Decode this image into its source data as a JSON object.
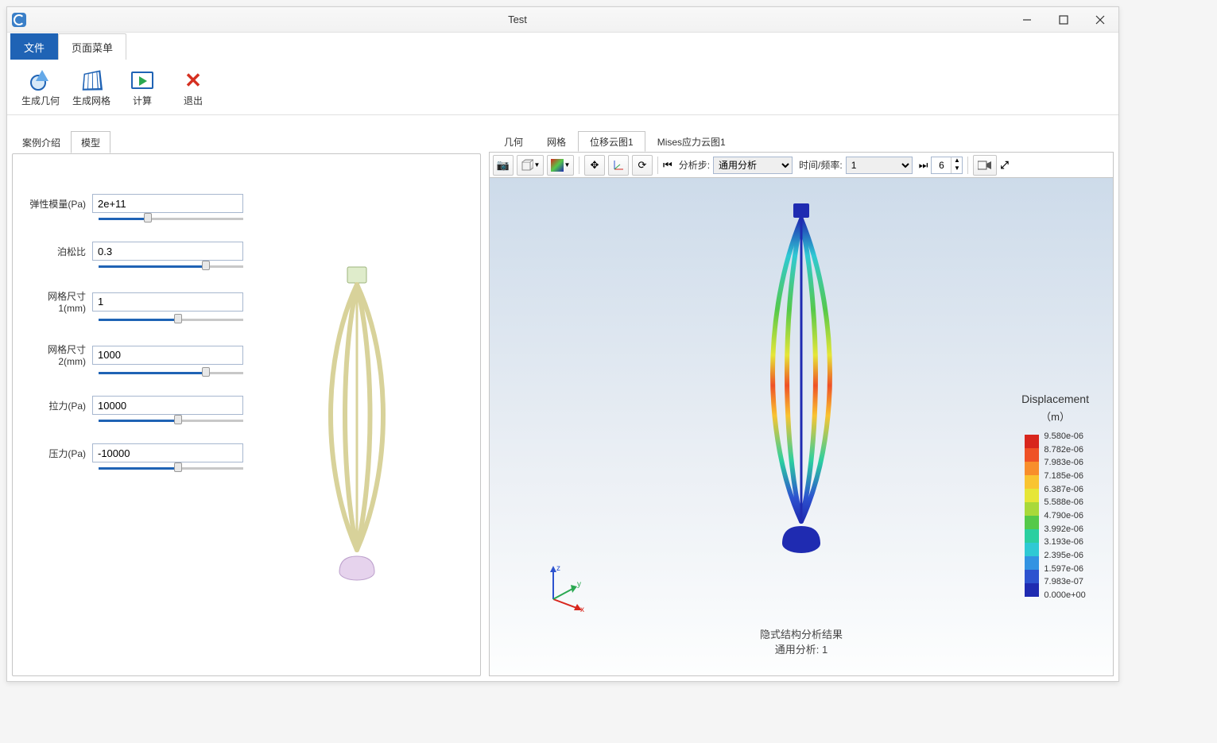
{
  "window": {
    "title": "Test"
  },
  "menu": {
    "tab_file": "文件",
    "tab_page": "页面菜单"
  },
  "ribbon": {
    "geom": "生成几何",
    "mesh": "生成网格",
    "calc": "计算",
    "exit": "退出"
  },
  "leftTabs": {
    "intro": "案例介绍",
    "model": "模型"
  },
  "params": [
    {
      "label": "弹性模量(Pa)",
      "value": "2e+11",
      "fill": 34
    },
    {
      "label": "泊松比",
      "value": "0.3",
      "fill": 74
    },
    {
      "label": "网格尺寸1(mm)",
      "value": "1",
      "fill": 55
    },
    {
      "label": "网格尺寸2(mm)",
      "value": "1000",
      "fill": 74
    },
    {
      "label": "拉力(Pa)",
      "value": "10000",
      "fill": 55
    },
    {
      "label": "压力(Pa)",
      "value": "-10000",
      "fill": 55
    }
  ],
  "rightTabs": {
    "geom": "几何",
    "mesh": "网格",
    "disp": "位移云图1",
    "mises": "Mises应力云图1"
  },
  "toolbar": {
    "analysis_step_label": "分析步:",
    "analysis_step_value": "通用分析",
    "time_label": "时间/频率:",
    "time_value": "1",
    "spin_value": "6"
  },
  "result": {
    "line1": "隐式结构分析结果",
    "line2": "通用分析: 1"
  },
  "legend": {
    "title": "Displacement",
    "unit": "（m）",
    "colors": [
      "#d8261d",
      "#ef5126",
      "#f88e2b",
      "#f9c431",
      "#e6e637",
      "#a9d93a",
      "#55c94a",
      "#2bcfa0",
      "#2fc9d4",
      "#3393e2",
      "#2d53cf",
      "#1f2bb1"
    ],
    "values": [
      "9.580e-06",
      "8.782e-06",
      "7.983e-06",
      "7.185e-06",
      "6.387e-06",
      "5.588e-06",
      "4.790e-06",
      "3.992e-06",
      "3.193e-06",
      "2.395e-06",
      "1.597e-06",
      "7.983e-07",
      "0.000e+00"
    ]
  },
  "triad": {
    "x": "x",
    "y": "y",
    "z": "z"
  }
}
